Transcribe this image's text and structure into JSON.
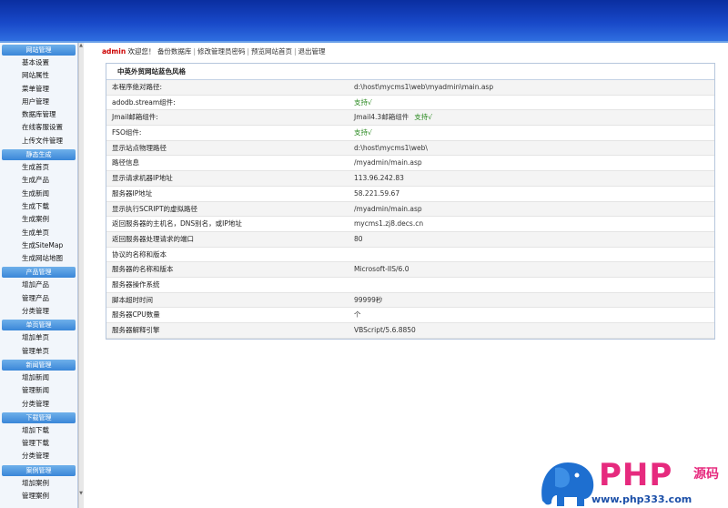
{
  "sidebar": {
    "groups": [
      {
        "head": "网站管理",
        "items": [
          "基本设置",
          "网站属性",
          "菜单管理",
          "用户管理",
          "数据库管理",
          "在线客服设置",
          "上传文件管理"
        ]
      },
      {
        "head": "静态生成",
        "items": [
          "生成首页",
          "生成产品",
          "生成新闻",
          "生成下载",
          "生成案例",
          "生成单页",
          "生成SiteMap",
          "生成网站地图"
        ]
      },
      {
        "head": "产品管理",
        "items": [
          "增加产品",
          "管理产品",
          "分类管理"
        ]
      },
      {
        "head": "单页管理",
        "items": [
          "增加单页",
          "管理单页"
        ]
      },
      {
        "head": "新闻管理",
        "items": [
          "增加新闻",
          "管理新闻",
          "分类管理"
        ]
      },
      {
        "head": "下载管理",
        "items": [
          "增加下载",
          "管理下载",
          "分类管理"
        ]
      },
      {
        "head": "案例管理",
        "items": [
          "增加案例",
          "管理案例"
        ]
      }
    ]
  },
  "nav": {
    "user": "admin",
    "welcome": "欢迎您！",
    "links": [
      "备份数据库",
      "修改管理员密码",
      "预览网站首页",
      "退出管理"
    ]
  },
  "info": {
    "title": "中英外贸网站蓝色风格",
    "rows": [
      {
        "k": "本程序绝对路径:",
        "v": "d:\\host\\mycms1\\web\\myadmin\\main.asp"
      },
      {
        "k": "adodb.stream组件:",
        "v": "支持√",
        "ok": true
      },
      {
        "k": "Jmail邮箱组件:",
        "v": "Jmail4.3邮箱组件",
        "v2": "支持√"
      },
      {
        "k": "FSO组件:",
        "v": "支持√",
        "ok": true
      },
      {
        "k": "显示站点物理路径",
        "v": "d:\\host\\mycms1\\web\\"
      },
      {
        "k": "路径信息",
        "v": "/myadmin/main.asp"
      },
      {
        "k": "显示请求机器IP地址",
        "v": "113.96.242.83"
      },
      {
        "k": "服务器IP地址",
        "v": "58.221.59.67"
      },
      {
        "k": "显示执行SCRIPT的虚拟路径",
        "v": "/myadmin/main.asp"
      },
      {
        "k": "返回服务器的主机名，DNS别名，或IP地址",
        "v": "mycms1.zj8.decs.cn"
      },
      {
        "k": "返回服务器处理请求的端口",
        "v": "80"
      },
      {
        "k": "协议的名称和版本",
        "v": ""
      },
      {
        "k": "服务器的名称和版本",
        "v": "Microsoft-IIS/6.0"
      },
      {
        "k": "服务器操作系统",
        "v": ""
      },
      {
        "k": "脚本超时时间",
        "v": "99999秒"
      },
      {
        "k": "服务器CPU数量",
        "v": "个"
      },
      {
        "k": "服务器解释引擎",
        "v": "VBScript/5.6.8850"
      }
    ]
  },
  "watermark": {
    "brand": "PHP",
    "cn": "源码",
    "url": "www.php333.com"
  },
  "colors": {
    "header": "#1848c8",
    "group_head": "#3a86d8",
    "accent_user": "#cc0000",
    "ok_green": "#2a8a20",
    "logo_pink": "#e62a7e",
    "logo_blue": "#1b4fa8"
  }
}
